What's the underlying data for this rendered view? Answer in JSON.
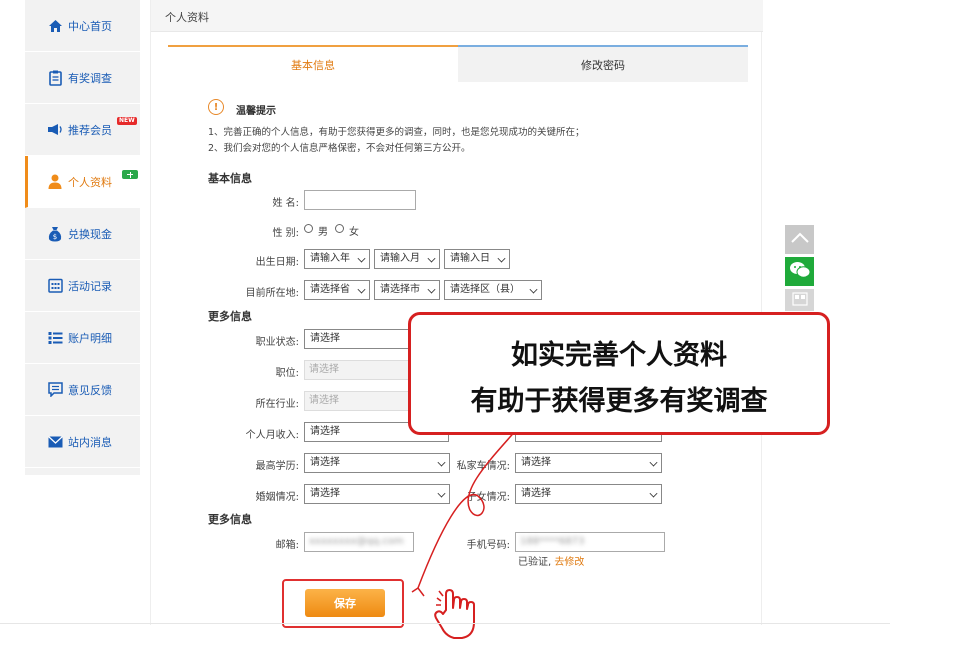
{
  "sidebar": {
    "items": [
      {
        "label": "中心首页",
        "icon": "home-icon"
      },
      {
        "label": "有奖调查",
        "icon": "clipboard-icon"
      },
      {
        "label": "推荐会员",
        "icon": "megaphone-icon",
        "badge": "NEW"
      },
      {
        "label": "个人资料",
        "icon": "user-icon",
        "active": true
      },
      {
        "label": "兑换现金",
        "icon": "money-bag-icon"
      },
      {
        "label": "活动记录",
        "icon": "calendar-icon"
      },
      {
        "label": "账户明细",
        "icon": "list-icon"
      },
      {
        "label": "意见反馈",
        "icon": "comment-icon"
      },
      {
        "label": "站内消息",
        "icon": "mail-icon"
      }
    ]
  },
  "page": {
    "title": "个人资料",
    "tabs": {
      "basic": "基本信息",
      "password": "修改密码"
    }
  },
  "tips": {
    "title": "温馨提示",
    "line1": "1、完善正确的个人信息，有助于您获得更多的调查，同时，也是您兑现成功的关键所在；",
    "line2": "2、我们会对您的个人信息严格保密，不会对任何第三方公开。"
  },
  "basic": {
    "section": "基本信息",
    "name_label": "姓 名:",
    "gender_label": "性 别:",
    "male": "男",
    "female": "女",
    "birth_label": "出生日期:",
    "year": "请输入年",
    "month": "请输入月",
    "day": "请输入日",
    "location_label": "目前所在地:",
    "province": "请选择省",
    "city": "请选择市",
    "district": "请选择区（县）"
  },
  "more": {
    "section": "更多信息",
    "job_status_label": "职业状态:",
    "position_label": "职位:",
    "industry_label": "所在行业:",
    "income_label": "个人月收入:",
    "education_label": "最高学历:",
    "car_label": "私家车情况:",
    "marriage_label": "婚姻情况:",
    "children_label": "子女情况:",
    "select_placeholder": "请选择"
  },
  "contact": {
    "section": "更多信息",
    "email_label": "邮箱:",
    "email_value": "xxxxxxxx@qq.com",
    "phone_label": "手机号码:",
    "phone_value": "188****6873",
    "verified": "已验证,",
    "change_link": "去修改"
  },
  "save_label": "保存",
  "callout": {
    "line1": "如实完善个人资料",
    "line2": "有助于获得更多有奖调查"
  },
  "colors": {
    "accent": "#f08c1a",
    "nav": "#1a5cb5",
    "callout_border": "#d62020"
  }
}
